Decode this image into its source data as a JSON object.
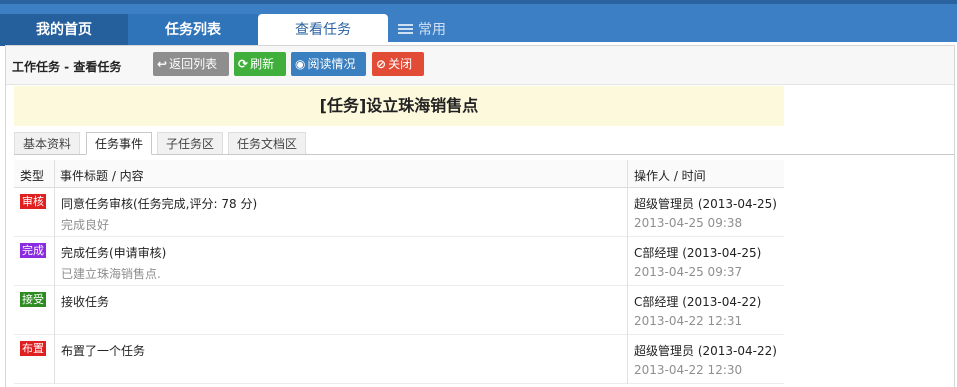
{
  "nav": {
    "home": "我的首页",
    "task_list": "任务列表",
    "view_task": "查看任务",
    "common": "常用"
  },
  "toolbar": {
    "title": "工作任务 - 查看任务",
    "back_label": "返回列表",
    "refresh_label": "刷新",
    "read_label": "阅读情况",
    "close_label": "关闭"
  },
  "headline": "[任务]设立珠海销售点",
  "subtabs": [
    "基本资料",
    "任务事件",
    "子任务区",
    "任务文档区"
  ],
  "active_subtab": "任务事件",
  "grid": {
    "headers": {
      "type": "类型",
      "title": "事件标题 / 内容",
      "operator": "操作人 / 时间"
    },
    "rows": [
      {
        "type": "审核",
        "type_color": "#e02020",
        "title": "同意任务审核(任务完成,评分: 78 分)",
        "content": "完成良好",
        "operator": "超级管理员 (2013-04-25)",
        "time": "2013-04-25 09:38"
      },
      {
        "type": "完成",
        "type_color": "#8a2be2",
        "title": "完成任务(申请审核)",
        "content": "已建立珠海销售点.",
        "operator": "C部经理 (2013-04-25)",
        "time": "2013-04-25 09:37"
      },
      {
        "type": "接受",
        "type_color": "#2e8b22",
        "title": "接收任务",
        "content": "",
        "operator": "C部经理 (2013-04-22)",
        "time": "2013-04-22 12:31"
      },
      {
        "type": "布置",
        "type_color": "#e02020",
        "title": "布置了一个任务",
        "content": "",
        "operator": "超级管理员 (2013-04-22)",
        "time": "2013-04-22 12:30"
      }
    ]
  }
}
